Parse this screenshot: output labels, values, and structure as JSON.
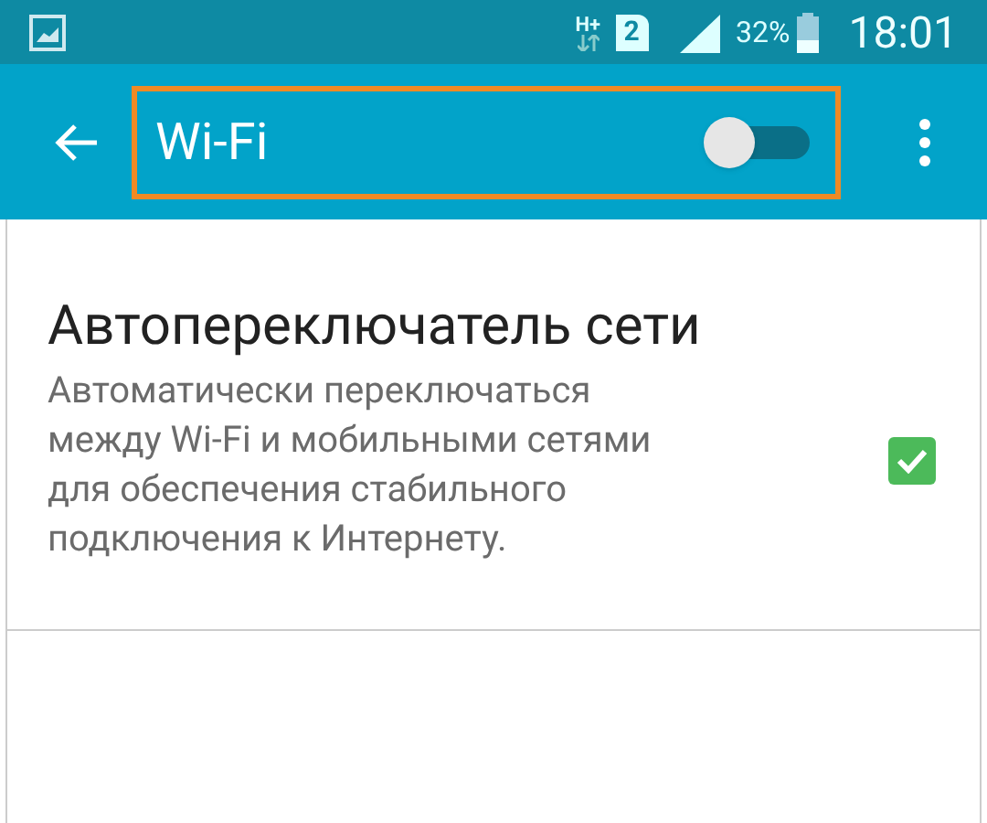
{
  "status_bar": {
    "network": "H+",
    "sim": "2",
    "battery": "32%",
    "time": "18:01"
  },
  "app_bar": {
    "title": "Wi-Fi",
    "wifi_on": false
  },
  "settings": [
    {
      "kind": "checkbox",
      "title": "Автопереключатель сети",
      "summary": "Автоматически переключаться между Wi-Fi и мобильными сетями для обеспечения стабильного подключения к Интернету.",
      "checked": true
    }
  ]
}
